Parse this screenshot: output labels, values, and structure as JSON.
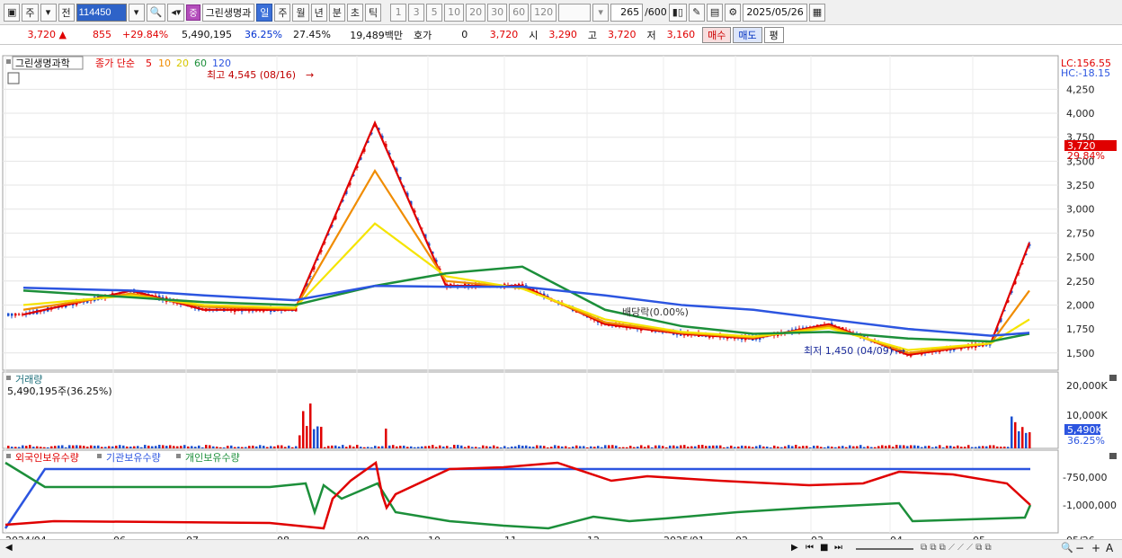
{
  "toolbar": {
    "type_label": "주",
    "prev_label": "전",
    "stock_code": "114450",
    "jung_badge": "중",
    "stock_name": "그린생명과",
    "periods": [
      "일",
      "주",
      "월",
      "년",
      "분",
      "초",
      "틱"
    ],
    "active_period": "일",
    "intervals": [
      "1",
      "3",
      "5",
      "10",
      "20",
      "30",
      "60",
      "120"
    ],
    "count_value": "265",
    "count_max": "/600",
    "date_value": "2025/05/26"
  },
  "quote": {
    "price": "3,720",
    "change": "855",
    "change_pct": "+29.84%",
    "volume": "5,490,195",
    "turnover_pct": "36.25%",
    "ratio_pct": "27.45%",
    "amount": "19,489백만",
    "hoga_label": "호가",
    "hoga_value": "0",
    "hoga_price": "3,720",
    "open_label": "시",
    "open": "3,290",
    "high_label": "고",
    "high": "3,720",
    "low_label": "저",
    "low": "3,160",
    "buy_label": "매수",
    "sell_label": "매도",
    "eval_label": "평"
  },
  "price_panel": {
    "legend_name": "그린생명과학",
    "ma_label": "종가 단순",
    "ma_periods": [
      "5",
      "10",
      "20",
      "60",
      "120"
    ],
    "ma_colors": [
      "#e00000",
      "#f08c00",
      "#f5e400",
      "#1c8f3a",
      "#2c55e0"
    ],
    "lc_label": "LC:156.55",
    "hc_label": "HC:-18.15",
    "high_annotation": "최고 4,545 (08/16)",
    "low_annotation": "최저 1,450 (04/09)",
    "dividend_annotation": "배당락(0.00%)",
    "current_price_tag": "3,720",
    "current_pct_tag": "29.84%",
    "y_ticks": [
      "4,250",
      "4,000",
      "3,750",
      "3,500",
      "3,250",
      "3,000",
      "2,750",
      "2,500",
      "2,250",
      "2,000",
      "1,750",
      "1,500"
    ]
  },
  "volume_panel": {
    "title": "거래량",
    "value_label": "5,490,195주(36.25%)",
    "y_ticks": [
      "20,000K",
      "10,000K"
    ],
    "current_tag": "5,490K",
    "current_pct": "36.25%"
  },
  "holding_panel": {
    "series": [
      "외국인보유수량",
      "기관보유수량",
      "개인보유수량"
    ],
    "series_colors": [
      "#e00000",
      "#2c55e0",
      "#1c8f3a"
    ],
    "y_ticks": [
      "-750,000",
      "-1,000,000"
    ]
  },
  "x_axis": {
    "labels": [
      "2024/04",
      "06",
      "07",
      "08",
      "09",
      "10",
      "11",
      "12",
      "2025/01",
      "02",
      "03",
      "04",
      "05",
      "05/26"
    ]
  },
  "chart_data": {
    "type": "line",
    "x": [
      "2024/04",
      "06",
      "07",
      "08",
      "09",
      "10",
      "11",
      "12",
      "2025/01",
      "02",
      "03",
      "04",
      "05",
      "05/26"
    ],
    "series": [
      {
        "name": "5",
        "values": [
          1900,
          2150,
          1950,
          1950,
          3900,
          2200,
          2200,
          1800,
          1700,
          1650,
          1800,
          1480,
          1600,
          2650
        ]
      },
      {
        "name": "10",
        "values": [
          1950,
          2120,
          1980,
          1960,
          3400,
          2250,
          2180,
          1820,
          1710,
          1660,
          1780,
          1500,
          1600,
          2150
        ]
      },
      {
        "name": "20",
        "values": [
          2000,
          2100,
          2000,
          1970,
          2850,
          2300,
          2170,
          1850,
          1720,
          1670,
          1760,
          1530,
          1600,
          1850
        ]
      },
      {
        "name": "60",
        "values": [
          2150,
          2080,
          2030,
          2000,
          2200,
          2330,
          2400,
          1950,
          1780,
          1700,
          1720,
          1650,
          1620,
          1700
        ]
      },
      {
        "name": "120",
        "values": [
          2180,
          2150,
          2100,
          2050,
          2200,
          2190,
          2190,
          2100,
          2000,
          1950,
          1850,
          1750,
          1680,
          1710
        ]
      }
    ],
    "ylim": [
      1400,
      4500
    ]
  }
}
